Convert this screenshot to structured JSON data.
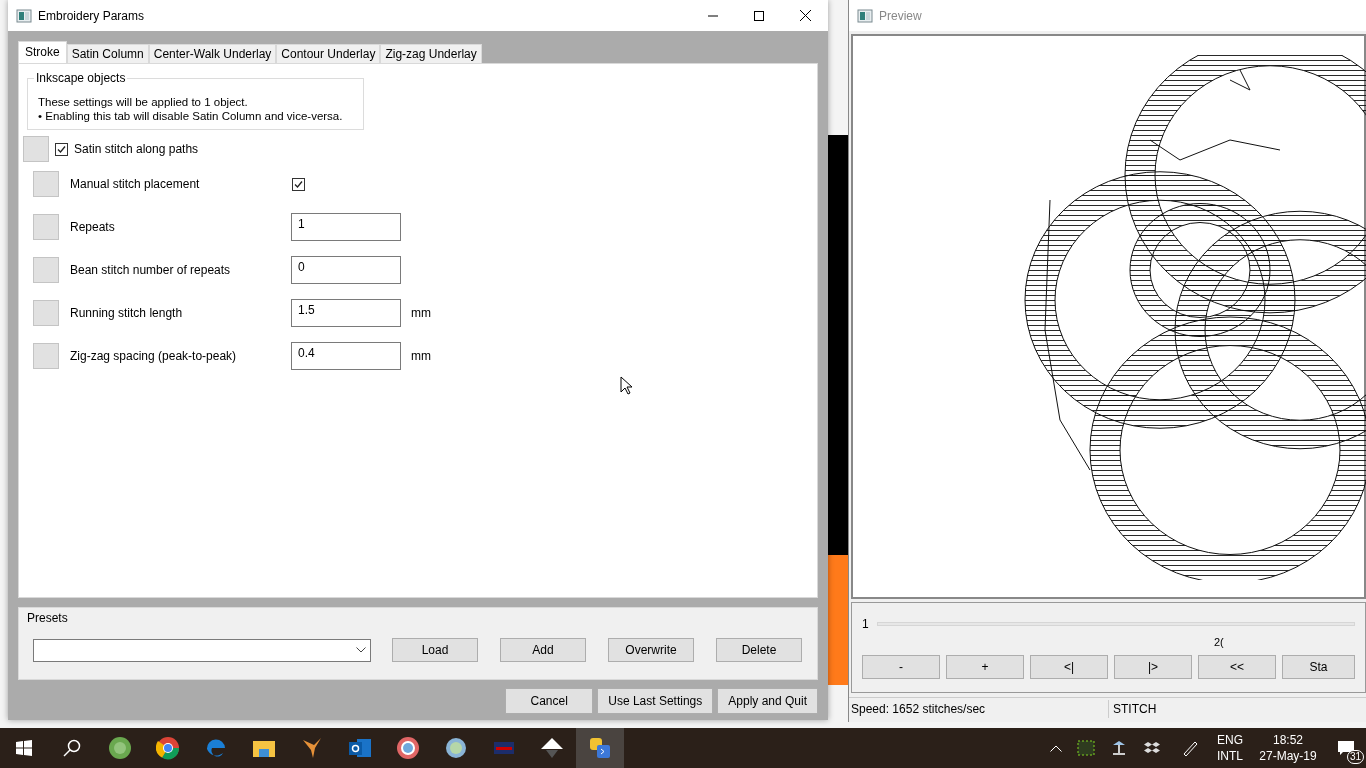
{
  "dialog": {
    "title": "Embroidery Params",
    "tabs": [
      {
        "label": "Stroke",
        "selected": true
      },
      {
        "label": "Satin Column",
        "selected": false
      },
      {
        "label": "Center-Walk Underlay",
        "selected": false
      },
      {
        "label": "Contour Underlay",
        "selected": false
      },
      {
        "label": "Zig-zag Underlay",
        "selected": false
      }
    ],
    "group": {
      "title": "Inkscape objects",
      "lines": [
        "These settings will be applied to 1 object.",
        "• Enabling this tab will disable Satin Column and vice-versa."
      ]
    },
    "enable": {
      "label": "Satin stitch along paths",
      "checked": true
    },
    "params": [
      {
        "kind": "checkbox",
        "label": "Manual stitch placement",
        "checked": true
      },
      {
        "kind": "number",
        "label": "Repeats",
        "value": "1"
      },
      {
        "kind": "number",
        "label": "Bean stitch number of repeats",
        "value": "0"
      },
      {
        "kind": "number",
        "label": "Running stitch length",
        "value": "1.5",
        "unit": "mm"
      },
      {
        "kind": "number",
        "label": "Zig-zag spacing (peak-to-peak)",
        "value": "0.4",
        "unit": "mm"
      }
    ],
    "presets": {
      "title": "Presets",
      "buttons": [
        "Load",
        "Add",
        "Overwrite",
        "Delete"
      ]
    },
    "buttons": [
      "Cancel",
      "Use Last Settings",
      "Apply and Quit"
    ]
  },
  "preview": {
    "title": "Preview",
    "stitch": "1",
    "fragment": "2(",
    "buttons": [
      "-",
      "+",
      "<|",
      "|>",
      "<<",
      "Sta"
    ],
    "status": [
      "Speed: 1652 stitches/sec",
      "STITCH"
    ]
  },
  "taskbar": {
    "language": [
      "ENG",
      "INTL"
    ],
    "time": "18:52",
    "date": "27-May-19",
    "notifications": "31"
  }
}
